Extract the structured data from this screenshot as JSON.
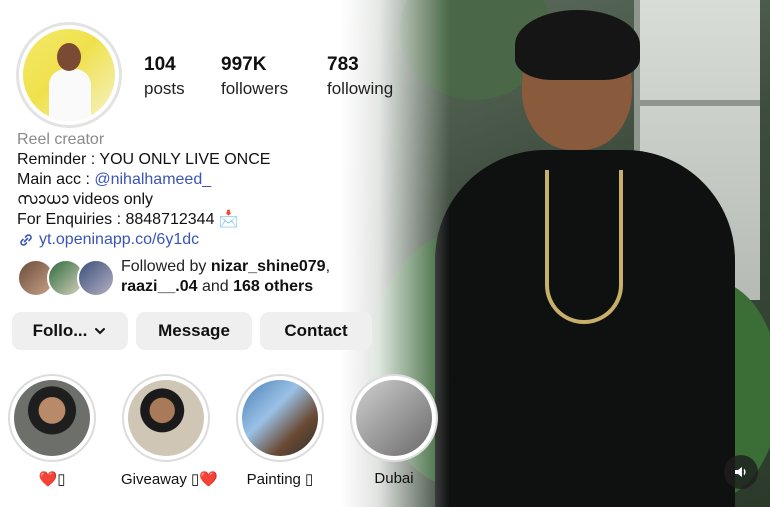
{
  "profile": {
    "stats": [
      {
        "num": "104",
        "label": "posts"
      },
      {
        "num": "997K",
        "label": "followers"
      },
      {
        "num": "783",
        "label": "following"
      }
    ],
    "category": "Reel creator",
    "bio_lines": [
      "Reminder : YOU ONLY LIVE ONCE",
      "Main acc : ",
      "സാധാ videos only",
      "For Enquiries : 8848712344 📩"
    ],
    "main_acc_handle": "@nihalhameed_",
    "link": "yt.openinapp.co/6y1dc",
    "followed_by": {
      "prefix": "Followed by ",
      "user1": "nizar_shine079",
      "sep": ",",
      "user2": "raazi__.04",
      "and": " and ",
      "others": "168 others"
    }
  },
  "buttons": {
    "follow": "Follo...",
    "message": "Message",
    "contact": "Contact"
  },
  "highlights": [
    {
      "label": "❤️▯"
    },
    {
      "label": "Giveaway ▯❤️"
    },
    {
      "label": "Painting ▯"
    },
    {
      "label": "Dubai"
    }
  ],
  "colors": {
    "link": "#3a55b8",
    "button_bg": "#efefef",
    "category": "#8a8a8a"
  }
}
